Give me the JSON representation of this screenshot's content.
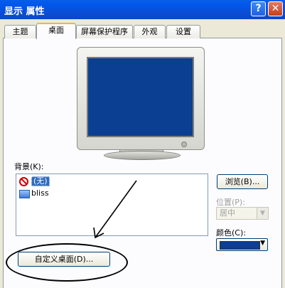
{
  "window": {
    "title": "显示 属性",
    "help_label": "?",
    "close_label": "✕"
  },
  "tabs": [
    {
      "label": "主题"
    },
    {
      "label": "桌面"
    },
    {
      "label": "屏幕保护程序"
    },
    {
      "label": "外观"
    },
    {
      "label": "设置"
    }
  ],
  "active_tab": "桌面",
  "desktop": {
    "background_label": "背景(K):",
    "background_items": [
      {
        "label": "(无)",
        "icon": "no-icon",
        "selected": true
      },
      {
        "label": "bliss",
        "icon": "jpg-file-icon",
        "selected": false
      }
    ],
    "browse_label": "浏览(B)...",
    "position_label": "位置(P):",
    "position_value": "居中",
    "color_label": "颜色(C):",
    "color_value": "#0a3f92",
    "customize_label": "自定义桌面(D)..."
  }
}
